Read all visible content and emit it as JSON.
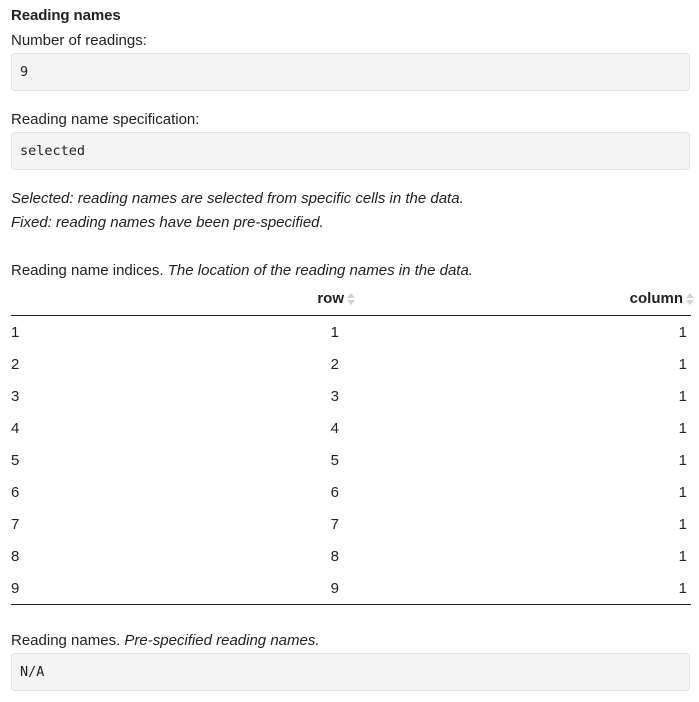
{
  "section": {
    "title": "Reading names"
  },
  "num_readings": {
    "label": "Number of readings:",
    "value": "9"
  },
  "name_spec": {
    "label": "Reading name specification:",
    "value": "selected"
  },
  "notes": {
    "selected": "Selected: reading names are selected from specific cells in the data.",
    "fixed": "Fixed: reading names have been pre-specified."
  },
  "indices": {
    "caption": "Reading name indices.",
    "caption_em": "The location of the reading names in the data.",
    "columns": [
      "row",
      "column"
    ],
    "rows": [
      {
        "idx": "1",
        "row": "1",
        "column": "1"
      },
      {
        "idx": "2",
        "row": "2",
        "column": "1"
      },
      {
        "idx": "3",
        "row": "3",
        "column": "1"
      },
      {
        "idx": "4",
        "row": "4",
        "column": "1"
      },
      {
        "idx": "5",
        "row": "5",
        "column": "1"
      },
      {
        "idx": "6",
        "row": "6",
        "column": "1"
      },
      {
        "idx": "7",
        "row": "7",
        "column": "1"
      },
      {
        "idx": "8",
        "row": "8",
        "column": "1"
      },
      {
        "idx": "9",
        "row": "9",
        "column": "1"
      }
    ]
  },
  "names": {
    "caption": "Reading names.",
    "caption_em": "Pre-specified reading names.",
    "value": "N/A"
  },
  "icons": {
    "sort": "sort-both-icon"
  }
}
